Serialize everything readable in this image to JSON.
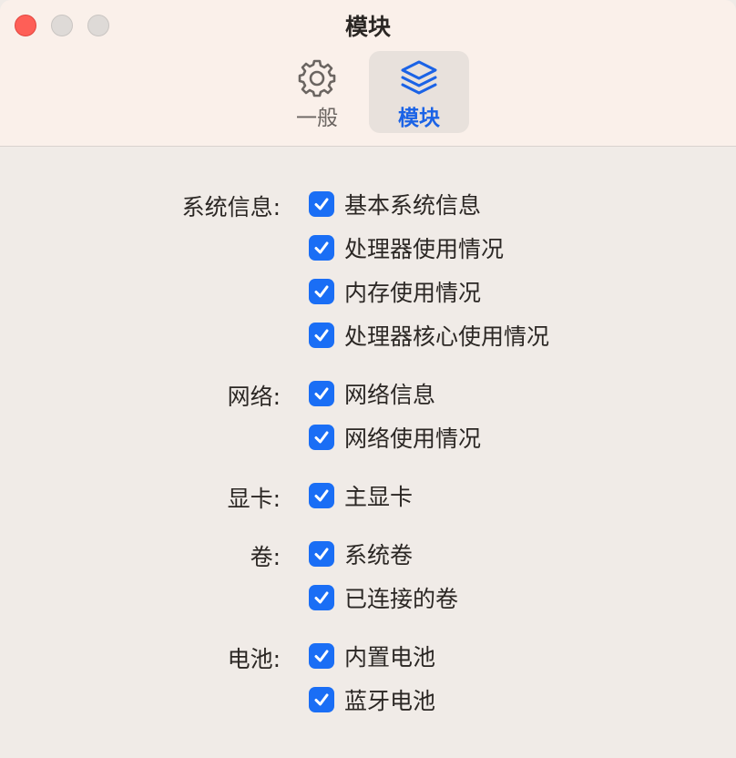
{
  "window": {
    "title": "模块"
  },
  "toolbar": {
    "tabs": [
      {
        "label": "一般",
        "icon": "gear-icon",
        "selected": false
      },
      {
        "label": "模块",
        "icon": "layers-icon",
        "selected": true
      }
    ]
  },
  "colors": {
    "accent": "#1a6ef5",
    "selected_tab_text": "#1b63e6",
    "close_button": "#fe5f57",
    "background": "#f0ebe7"
  },
  "groups": [
    {
      "label": "系统信息:",
      "options": [
        {
          "label": "基本系统信息",
          "checked": true
        },
        {
          "label": "处理器使用情况",
          "checked": true
        },
        {
          "label": "内存使用情况",
          "checked": true
        },
        {
          "label": "处理器核心使用情况",
          "checked": true
        }
      ]
    },
    {
      "label": "网络:",
      "options": [
        {
          "label": "网络信息",
          "checked": true
        },
        {
          "label": "网络使用情况",
          "checked": true
        }
      ]
    },
    {
      "label": "显卡:",
      "options": [
        {
          "label": "主显卡",
          "checked": true
        }
      ]
    },
    {
      "label": "卷:",
      "options": [
        {
          "label": "系统卷",
          "checked": true
        },
        {
          "label": "已连接的卷",
          "checked": true
        }
      ]
    },
    {
      "label": "电池:",
      "options": [
        {
          "label": "内置电池",
          "checked": true
        },
        {
          "label": "蓝牙电池",
          "checked": true
        }
      ]
    }
  ]
}
